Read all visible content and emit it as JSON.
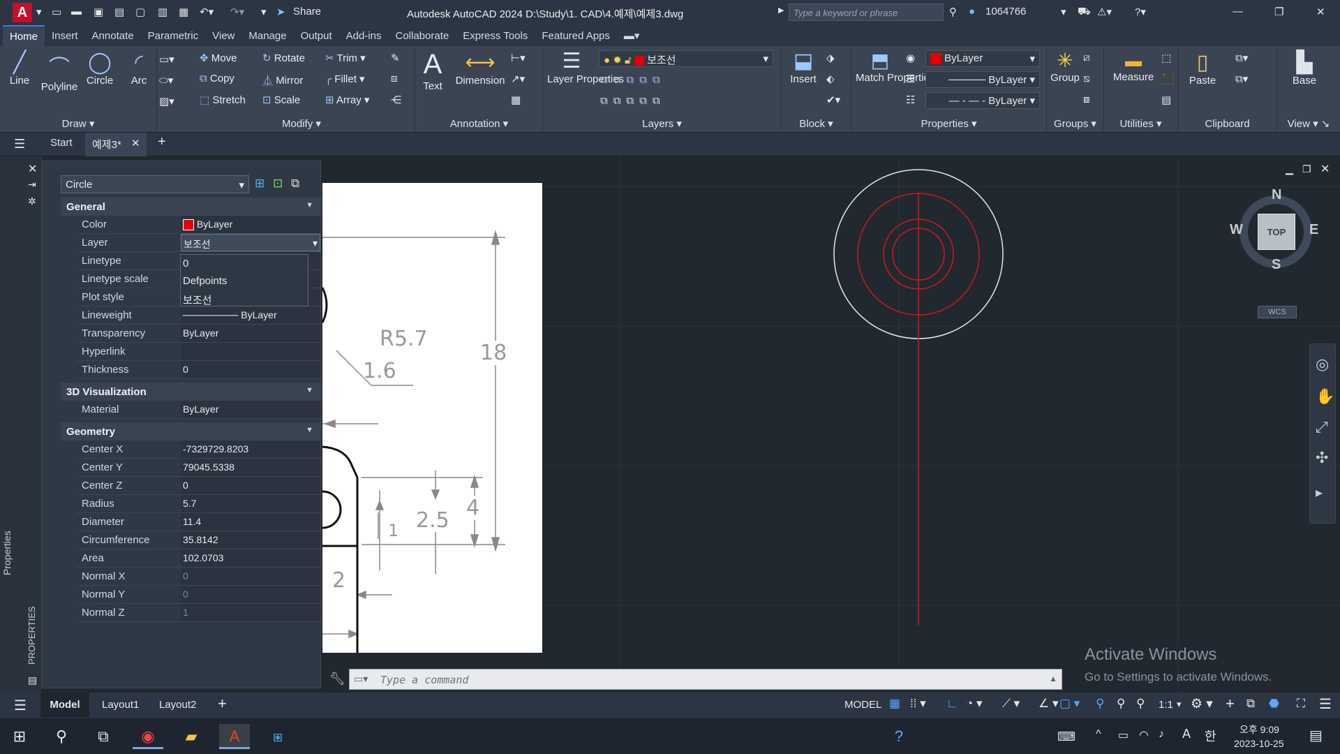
{
  "titlebar": {
    "logo": "A",
    "share_label": "Share",
    "title": "Autodesk AutoCAD 2024    D:\\Study\\1. CAD\\4.예제\\예제3.dwg",
    "search_placeholder": "Type a keyword or phrase",
    "user": "1064766"
  },
  "menu_tabs": [
    "Home",
    "Insert",
    "Annotate",
    "Parametric",
    "View",
    "Manage",
    "Output",
    "Add-ins",
    "Collaborate",
    "Express Tools",
    "Featured Apps"
  ],
  "ribbon": {
    "draw": {
      "title": "Draw",
      "line": "Line",
      "polyline": "Polyline",
      "circle": "Circle",
      "arc": "Arc"
    },
    "modify": {
      "title": "Modify",
      "move": "Move",
      "rotate": "Rotate",
      "trim": "Trim",
      "copy": "Copy",
      "mirror": "Mirror",
      "fillet": "Fillet",
      "stretch": "Stretch",
      "scale": "Scale",
      "array": "Array"
    },
    "annotation": {
      "title": "Annotation",
      "text": "Text",
      "dimension": "Dimension"
    },
    "layers": {
      "title": "Layers",
      "layer_properties": "Layer Properties",
      "current_layer": "보조선"
    },
    "block": {
      "title": "Block",
      "insert": "Insert"
    },
    "properties": {
      "title": "Properties",
      "match": "Match Properties",
      "color": "ByLayer",
      "lineweight": "ByLayer",
      "linetype": "ByLayer"
    },
    "groups": {
      "title": "Groups",
      "group": "Group"
    },
    "utilities": {
      "title": "Utilities",
      "measure": "Measure"
    },
    "clipboard": {
      "title": "Clipboard",
      "paste": "Paste"
    },
    "view": {
      "title": "View",
      "base": "Base"
    }
  },
  "file_tabs": {
    "start": "Start",
    "active": "예제3*"
  },
  "palette": {
    "vertical_title": "PROPERTIES",
    "side_title": "Properties",
    "object_type": "Circle",
    "general": {
      "title": "General",
      "color_label": "Color",
      "color_value": "ByLayer",
      "layer_label": "Layer",
      "layer_value": "보조선",
      "linetype_label": "Linetype",
      "linetype_scale_label": "Linetype scale",
      "plot_style_label": "Plot style",
      "lineweight_label": "Lineweight",
      "lineweight_value": "ByLayer",
      "transparency_label": "Transparency",
      "transparency_value": "ByLayer",
      "hyperlink_label": "Hyperlink",
      "thickness_label": "Thickness",
      "thickness_value": "0"
    },
    "layer_options": [
      "0",
      "Defpoints",
      "보조선"
    ],
    "visualization": {
      "title": "3D Visualization",
      "material_label": "Material",
      "material_value": "ByLayer"
    },
    "geometry": {
      "title": "Geometry",
      "rows": [
        {
          "label": "Center X",
          "value": "-7329729.8203"
        },
        {
          "label": "Center Y",
          "value": "79045.5338"
        },
        {
          "label": "Center Z",
          "value": "0"
        },
        {
          "label": "Radius",
          "value": "5.7"
        },
        {
          "label": "Diameter",
          "value": "11.4"
        },
        {
          "label": "Circumference",
          "value": "35.8142"
        },
        {
          "label": "Area",
          "value": "102.0703"
        },
        {
          "label": "Normal X",
          "value": "0"
        },
        {
          "label": "Normal Y",
          "value": "0"
        },
        {
          "label": "Normal Z",
          "value": "1"
        }
      ]
    }
  },
  "drawing_labels": {
    "r57": "R5.7",
    "d16": "1.6",
    "d18": "18",
    "d4": "4",
    "d25": "2.5",
    "d1": "1",
    "d2": "2"
  },
  "viewcube": {
    "n": "N",
    "s": "S",
    "e": "E",
    "w": "W",
    "top": "TOP",
    "wcs": "WCS"
  },
  "command": {
    "placeholder": "Type a command"
  },
  "watermark": {
    "title": "Activate Windows",
    "subtitle": "Go to Settings to activate Windows."
  },
  "status": {
    "model_tab": "Model",
    "layout1": "Layout1",
    "layout2": "Layout2",
    "model_mode": "MODEL",
    "scale": "1:1"
  },
  "taskbar": {
    "ampm": "오후 9:09",
    "date": "2023-10-25",
    "ime": "한",
    "lang": "A"
  }
}
